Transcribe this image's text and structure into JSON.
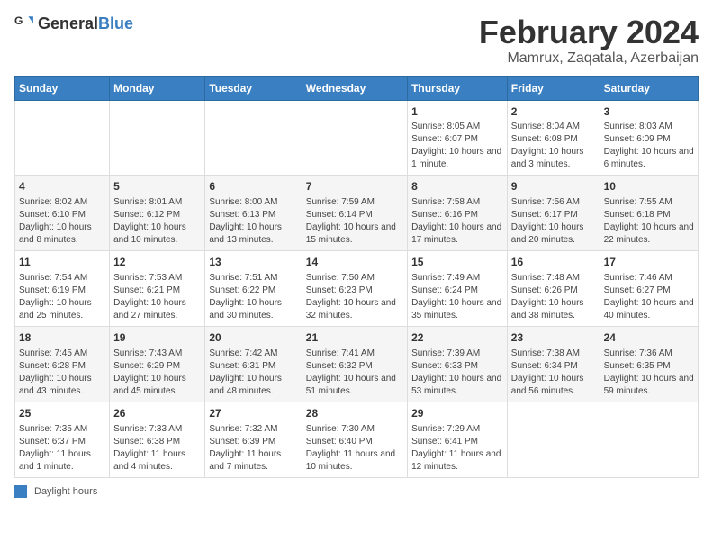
{
  "header": {
    "logo_general": "General",
    "logo_blue": "Blue",
    "title": "February 2024",
    "subtitle": "Mamrux, Zaqatala, Azerbaijan"
  },
  "days_of_week": [
    "Sunday",
    "Monday",
    "Tuesday",
    "Wednesday",
    "Thursday",
    "Friday",
    "Saturday"
  ],
  "weeks": [
    [
      {
        "day": "",
        "info": ""
      },
      {
        "day": "",
        "info": ""
      },
      {
        "day": "",
        "info": ""
      },
      {
        "day": "",
        "info": ""
      },
      {
        "day": "1",
        "info": "Sunrise: 8:05 AM\nSunset: 6:07 PM\nDaylight: 10 hours and 1 minute."
      },
      {
        "day": "2",
        "info": "Sunrise: 8:04 AM\nSunset: 6:08 PM\nDaylight: 10 hours and 3 minutes."
      },
      {
        "day": "3",
        "info": "Sunrise: 8:03 AM\nSunset: 6:09 PM\nDaylight: 10 hours and 6 minutes."
      }
    ],
    [
      {
        "day": "4",
        "info": "Sunrise: 8:02 AM\nSunset: 6:10 PM\nDaylight: 10 hours and 8 minutes."
      },
      {
        "day": "5",
        "info": "Sunrise: 8:01 AM\nSunset: 6:12 PM\nDaylight: 10 hours and 10 minutes."
      },
      {
        "day": "6",
        "info": "Sunrise: 8:00 AM\nSunset: 6:13 PM\nDaylight: 10 hours and 13 minutes."
      },
      {
        "day": "7",
        "info": "Sunrise: 7:59 AM\nSunset: 6:14 PM\nDaylight: 10 hours and 15 minutes."
      },
      {
        "day": "8",
        "info": "Sunrise: 7:58 AM\nSunset: 6:16 PM\nDaylight: 10 hours and 17 minutes."
      },
      {
        "day": "9",
        "info": "Sunrise: 7:56 AM\nSunset: 6:17 PM\nDaylight: 10 hours and 20 minutes."
      },
      {
        "day": "10",
        "info": "Sunrise: 7:55 AM\nSunset: 6:18 PM\nDaylight: 10 hours and 22 minutes."
      }
    ],
    [
      {
        "day": "11",
        "info": "Sunrise: 7:54 AM\nSunset: 6:19 PM\nDaylight: 10 hours and 25 minutes."
      },
      {
        "day": "12",
        "info": "Sunrise: 7:53 AM\nSunset: 6:21 PM\nDaylight: 10 hours and 27 minutes."
      },
      {
        "day": "13",
        "info": "Sunrise: 7:51 AM\nSunset: 6:22 PM\nDaylight: 10 hours and 30 minutes."
      },
      {
        "day": "14",
        "info": "Sunrise: 7:50 AM\nSunset: 6:23 PM\nDaylight: 10 hours and 32 minutes."
      },
      {
        "day": "15",
        "info": "Sunrise: 7:49 AM\nSunset: 6:24 PM\nDaylight: 10 hours and 35 minutes."
      },
      {
        "day": "16",
        "info": "Sunrise: 7:48 AM\nSunset: 6:26 PM\nDaylight: 10 hours and 38 minutes."
      },
      {
        "day": "17",
        "info": "Sunrise: 7:46 AM\nSunset: 6:27 PM\nDaylight: 10 hours and 40 minutes."
      }
    ],
    [
      {
        "day": "18",
        "info": "Sunrise: 7:45 AM\nSunset: 6:28 PM\nDaylight: 10 hours and 43 minutes."
      },
      {
        "day": "19",
        "info": "Sunrise: 7:43 AM\nSunset: 6:29 PM\nDaylight: 10 hours and 45 minutes."
      },
      {
        "day": "20",
        "info": "Sunrise: 7:42 AM\nSunset: 6:31 PM\nDaylight: 10 hours and 48 minutes."
      },
      {
        "day": "21",
        "info": "Sunrise: 7:41 AM\nSunset: 6:32 PM\nDaylight: 10 hours and 51 minutes."
      },
      {
        "day": "22",
        "info": "Sunrise: 7:39 AM\nSunset: 6:33 PM\nDaylight: 10 hours and 53 minutes."
      },
      {
        "day": "23",
        "info": "Sunrise: 7:38 AM\nSunset: 6:34 PM\nDaylight: 10 hours and 56 minutes."
      },
      {
        "day": "24",
        "info": "Sunrise: 7:36 AM\nSunset: 6:35 PM\nDaylight: 10 hours and 59 minutes."
      }
    ],
    [
      {
        "day": "25",
        "info": "Sunrise: 7:35 AM\nSunset: 6:37 PM\nDaylight: 11 hours and 1 minute."
      },
      {
        "day": "26",
        "info": "Sunrise: 7:33 AM\nSunset: 6:38 PM\nDaylight: 11 hours and 4 minutes."
      },
      {
        "day": "27",
        "info": "Sunrise: 7:32 AM\nSunset: 6:39 PM\nDaylight: 11 hours and 7 minutes."
      },
      {
        "day": "28",
        "info": "Sunrise: 7:30 AM\nSunset: 6:40 PM\nDaylight: 11 hours and 10 minutes."
      },
      {
        "day": "29",
        "info": "Sunrise: 7:29 AM\nSunset: 6:41 PM\nDaylight: 11 hours and 12 minutes."
      },
      {
        "day": "",
        "info": ""
      },
      {
        "day": "",
        "info": ""
      }
    ]
  ],
  "legend": {
    "color_label": "Daylight hours"
  }
}
